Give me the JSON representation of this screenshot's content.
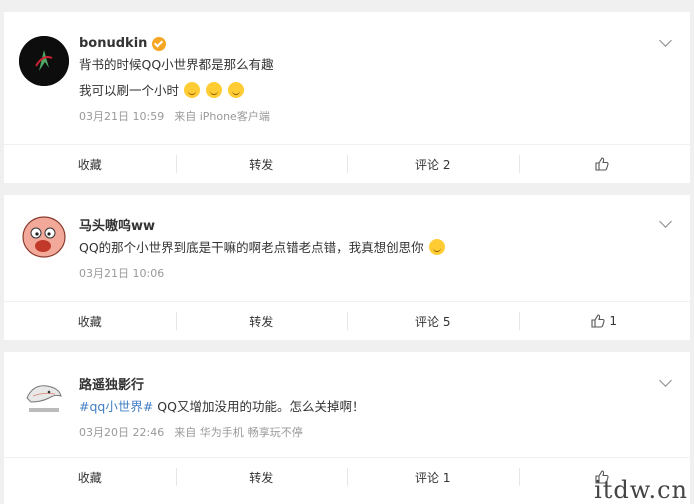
{
  "posts": [
    {
      "username": "bonudkin",
      "verified": true,
      "lines": [
        "背书的时候QQ小世界都是那么有趣",
        "我可以刷一个小时"
      ],
      "emoji_count_line2": 3,
      "date": "03月21日 10:59",
      "source": "来自 iPhone客户端",
      "actions": {
        "collect": "收藏",
        "repost": "转发",
        "comment": "评论 2",
        "like": ""
      }
    },
    {
      "username": "马头嗷呜ww",
      "lines": [
        "QQ的那个小世界到底是干嘛的啊老点错老点错，我真想创思你"
      ],
      "date": "03月21日 10:06",
      "actions": {
        "collect": "收藏",
        "repost": "转发",
        "comment": "评论 5",
        "like": "1"
      }
    },
    {
      "username": "路遥独影行",
      "hashtag": "#qq小世界#",
      "text_after_tag": " QQ又增加没用的功能。怎么关掉啊！",
      "date": "03月20日 22:46",
      "source": "来自 华为手机",
      "source2": "畅享玩不停",
      "actions": {
        "collect": "收藏",
        "repost": "转发",
        "comment": "评论 1",
        "like": ""
      }
    }
  ],
  "watermark": "itdw.cn",
  "colors": {
    "background": "#f0f0f0",
    "card": "#ffffff",
    "hashtag": "#3f7fc5",
    "verified": "#f6a623"
  },
  "icons": [
    "verified-icon",
    "chevron-down-icon",
    "like-icon",
    "emoji-icon"
  ]
}
